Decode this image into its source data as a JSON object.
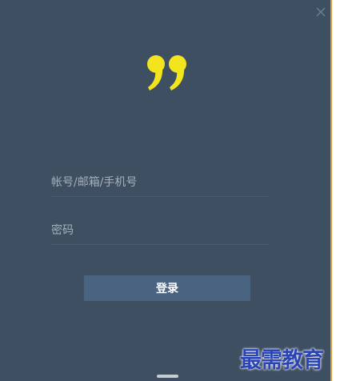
{
  "login": {
    "account_placeholder": "帐号/邮箱/手机号",
    "account_value": "",
    "password_placeholder": "密码",
    "password_value": "",
    "login_label": "登录"
  },
  "icons": {
    "close": "close-icon",
    "logo": "quote-logo-icon",
    "resize": "drag-handle"
  },
  "watermark": {
    "text": "最需教育"
  },
  "colors": {
    "window_bg": "#3d4f61",
    "button_bg": "#4a6381",
    "logo_yellow": "#f2e51e",
    "edge_accent": "#e49b3c",
    "watermark_blue": "#2a44b6"
  }
}
